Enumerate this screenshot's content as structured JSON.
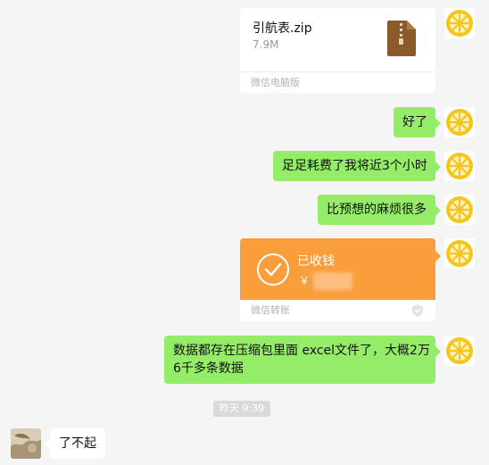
{
  "file_message": {
    "name": "引航表.zip",
    "size": "7.9M",
    "source": "微信电脑版",
    "icon": "zip-file-icon"
  },
  "messages": [
    "好了",
    "足足耗费了我将近3个小时",
    "比预想的麻烦很多"
  ],
  "transfer": {
    "status": "已收钱",
    "currency": "￥",
    "footer": "微信转账",
    "color": "#fa9d3b"
  },
  "long_message_lines": [
    "数据都存在压缩包里面 excel文件了，大概2万",
    "6千多条数据"
  ],
  "timestamp": "昨天 9:39",
  "reply": "了不起",
  "colors": {
    "bubble_self": "#95ec69",
    "bubble_other": "#ffffff",
    "background": "#f5f5f5"
  }
}
